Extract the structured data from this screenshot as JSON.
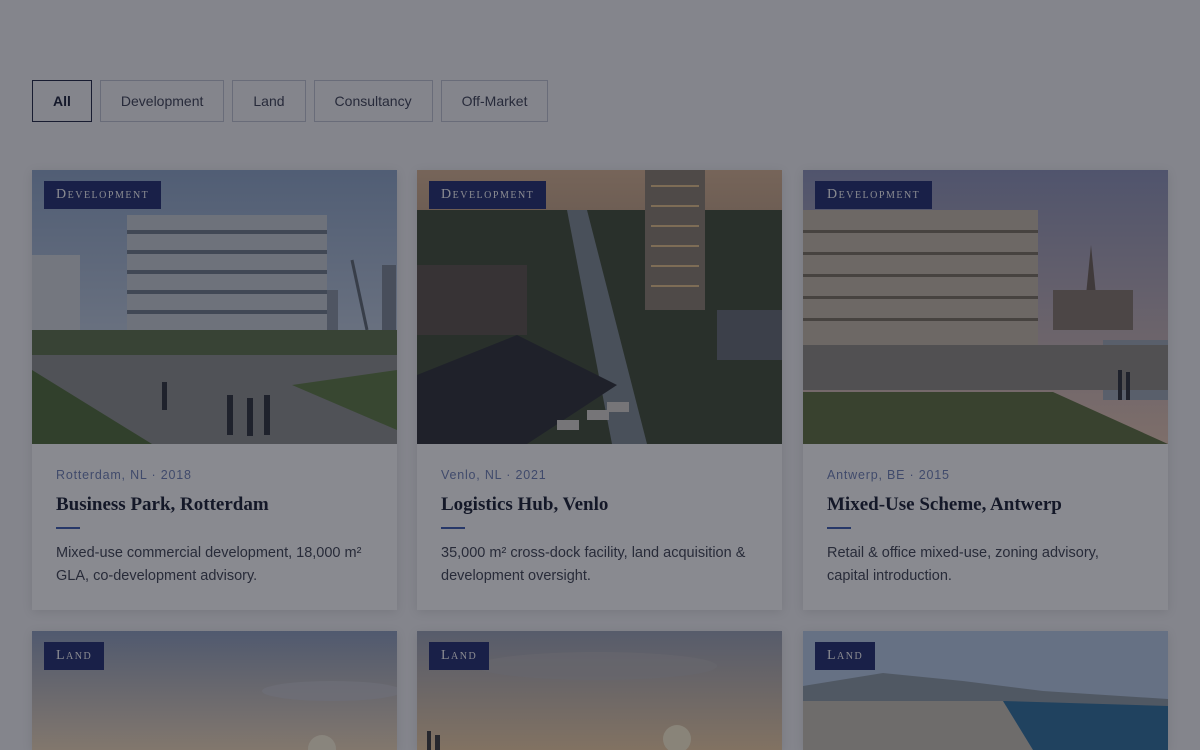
{
  "filters": [
    {
      "label": "All",
      "active": true
    },
    {
      "label": "Development",
      "active": false
    },
    {
      "label": "Land",
      "active": false
    },
    {
      "label": "Consultancy",
      "active": false
    },
    {
      "label": "Off-Market",
      "active": false
    }
  ],
  "projects": [
    {
      "badge": "Development",
      "meta": "Rotterdam, NL · 2018",
      "title": "Business Park, Rotterdam",
      "description": "Mixed-use commercial development, 18,000 m² GLA, co-development advisory."
    },
    {
      "badge": "Development",
      "meta": "Venlo, NL · 2021",
      "title": "Logistics Hub, Venlo",
      "description": "35,000 m² cross-dock facility, land acquisition & development oversight."
    },
    {
      "badge": "Development",
      "meta": "Antwerp, BE · 2015",
      "title": "Mixed-Use Scheme, Antwerp",
      "description": "Retail & office mixed-use, zoning advisory, capital introduction."
    },
    {
      "badge": "Land"
    },
    {
      "badge": "Land"
    },
    {
      "badge": "Land"
    }
  ],
  "colors": {
    "badge_bg": "#1e2a6e",
    "accent_rule": "#3b5bb0",
    "overlay": "rgba(20,22,34,0.50)"
  }
}
